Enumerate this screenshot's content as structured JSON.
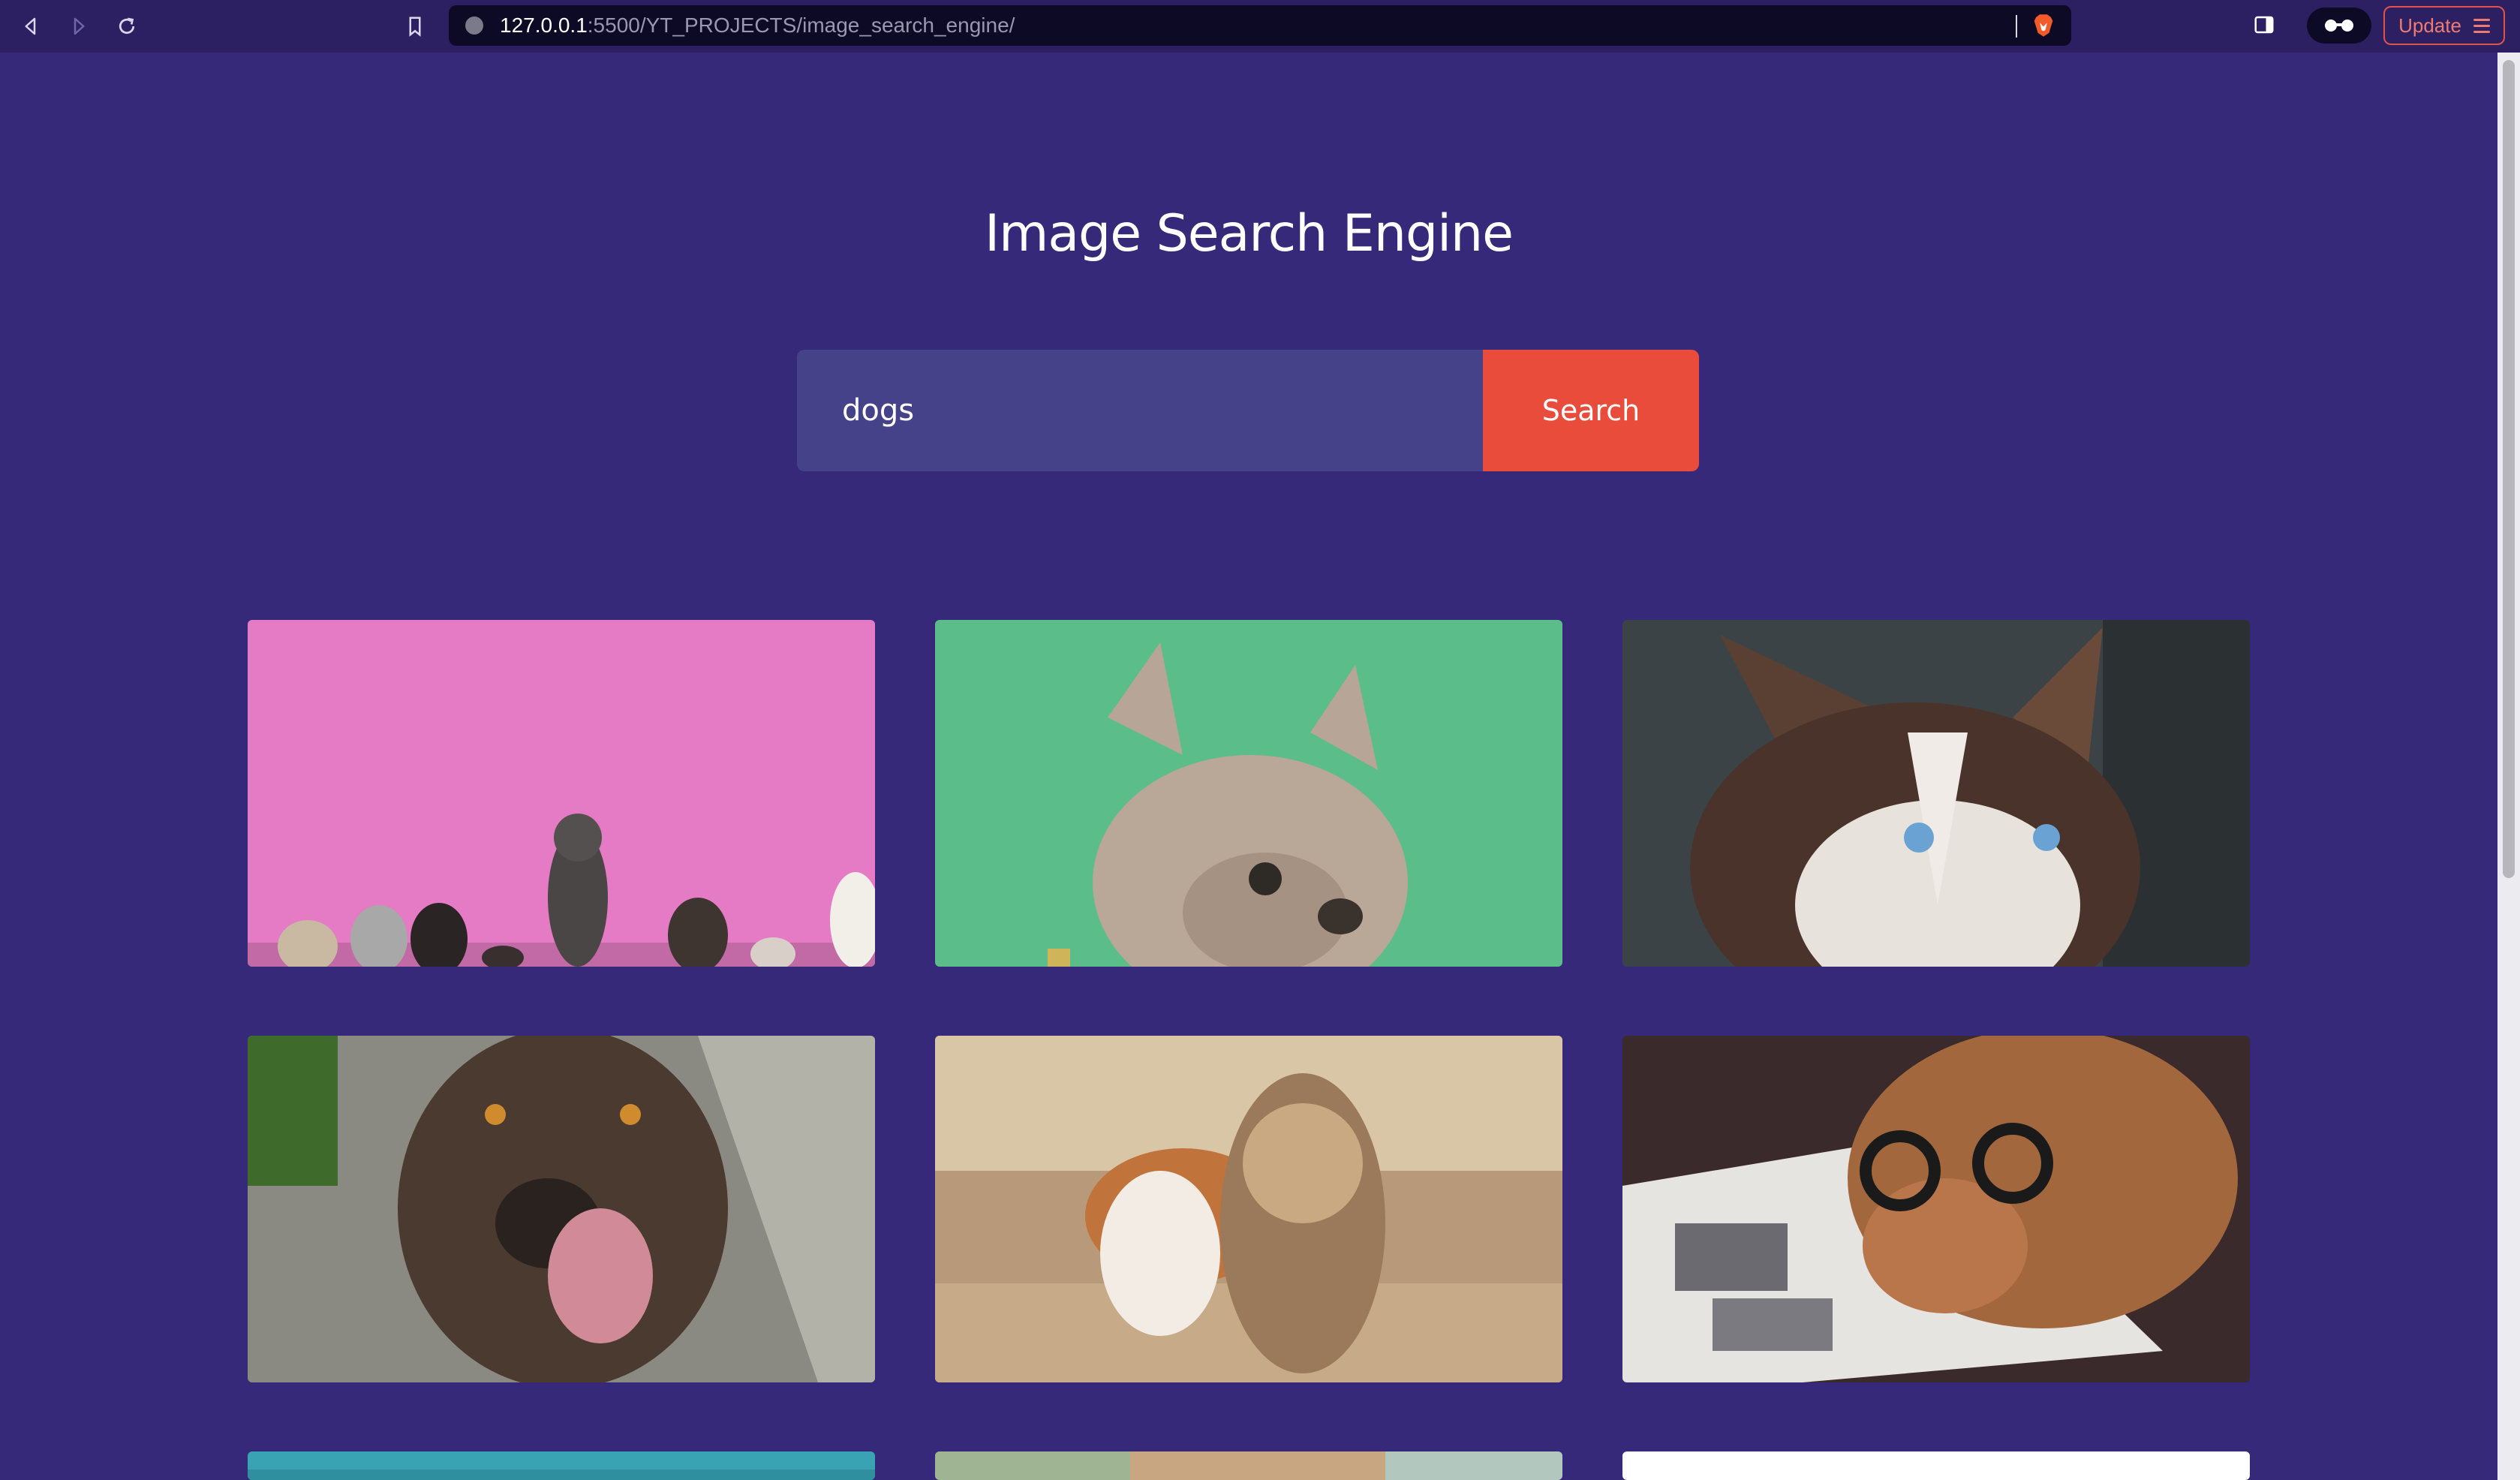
{
  "browser": {
    "url_host": "127.0.0.1",
    "url_rest": ":5500/YT_PROJECTS/image_search_engine/",
    "update_label": "Update",
    "icons": [
      "back-icon",
      "forward-icon",
      "reload-icon",
      "bookmark-icon",
      "site-info-icon",
      "brave-shield-icon",
      "sidebar-icon",
      "reader-mode-icon",
      "menu-icon"
    ]
  },
  "page": {
    "title": "Image Search Engine",
    "search": {
      "value": "dogs",
      "button_label": "Search"
    }
  },
  "results": [
    {
      "subject": "dogs-sitting-against-pink-wall"
    },
    {
      "subject": "french-bulldog-green-background"
    },
    {
      "subject": "husky-blue-eyes"
    },
    {
      "subject": "labrador-licking-nose"
    },
    {
      "subject": "corgi-and-yorkie-running"
    },
    {
      "subject": "dog-with-glasses-reading-magazine"
    },
    {
      "subject": "teal-image-partial"
    },
    {
      "subject": "outdoor-image-partial"
    },
    {
      "subject": "white-image-partial"
    }
  ],
  "colors": {
    "background": "#37297a",
    "input_bg": "#46428a",
    "accent": "#ea4c3c"
  }
}
